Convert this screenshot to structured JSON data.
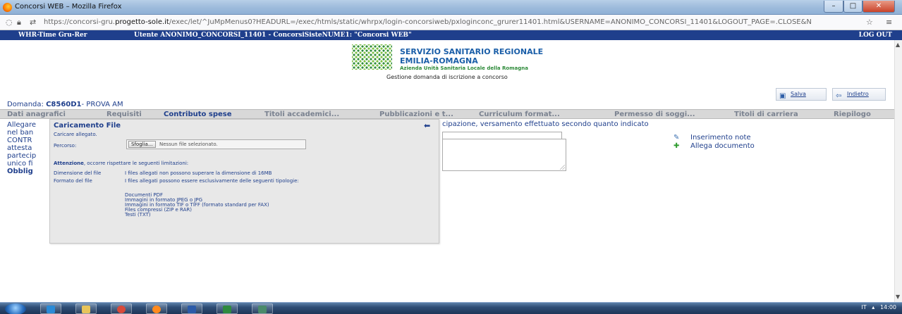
{
  "browser": {
    "window_title": "Concorsi WEB – Mozilla Firefox",
    "url_prefix": "https://concorsi-gru.",
    "url_domain": "progetto-sole.it",
    "url_suffix": "/exec/let/^JuMpMenus0?HEADURL=/exec/htmls/static/whrpx/login-concorsiweb/pxloginconc_grurer11401.html&USERNAME=ANONIMO_CONCORSI_11401&LOGOUT_PAGE=.CLOSE&N"
  },
  "appbar": {
    "left": "WHR-Time Gru-Rer",
    "user": "Utente ANONIMO_CONCORSI_11401 - ConcorsiSisteNUME1: \"Concorsi WEB\"",
    "logout": "LOG OUT"
  },
  "header": {
    "logo_line1": "SERVIZIO SANITARIO REGIONALE",
    "logo_line2": "EMILIA-ROMAGNA",
    "logo_line3": "Azienda Unità Sanitaria Locale della Romagna",
    "subtitle": "Gestione domanda di iscrizione a concorso"
  },
  "toolbar": {
    "save": "Salva",
    "back": "Indietro"
  },
  "domanda": {
    "label": "Domanda:",
    "code": "C8560D1",
    "name": "- PROVA AM"
  },
  "tabs": [
    {
      "label": "Dati anagrafici"
    },
    {
      "label": "Requisiti"
    },
    {
      "label": "Contributo spese"
    },
    {
      "label": "Titoli accademici..."
    },
    {
      "label": "Pubblicazioni e t..."
    },
    {
      "label": "Curriculum format..."
    },
    {
      "label": "Permesso di soggi..."
    },
    {
      "label": "Titoli di carriera"
    },
    {
      "label": "Riepilogo"
    }
  ],
  "body": {
    "l1": "Allegare",
    "l2": "nel ban",
    "l3": "CONTR",
    "l4": "attesta",
    "l5": "partecip",
    "l6": "unico fi",
    "l7": "Obblig",
    "main_text": "cipazione, versamento effettuato secondo quanto indicato"
  },
  "side_links": {
    "notes": "Inserimento note",
    "attach": "Allega documento"
  },
  "dialog": {
    "title": "Caricamento File",
    "subtitle": "Caricare allegato.",
    "path_label": "Percorso:",
    "browse": "Sfoglia...",
    "no_file": "Nessun file selezionato.",
    "attention_bold": "Attenzione",
    "attention_rest": ", occorre rispettare le seguenti limitazioni:",
    "size_label": "Dimensione del file",
    "size_value": "I files allegati non possono superare la dimensione di 16MB",
    "format_label": "Formato del file",
    "format_value": "I files allegati possono essere esclusivamente delle seguenti tipologie:",
    "types": [
      "Documenti PDF",
      "Immagini in formato JPEG o JPG",
      "Immagini in formato TIF o TIFF (formato standard per FAX)",
      "Files compressi (ZIP e RAR)",
      "Testi (TXT)"
    ]
  },
  "taskbar": {
    "lang": "IT",
    "time": "14:00"
  }
}
